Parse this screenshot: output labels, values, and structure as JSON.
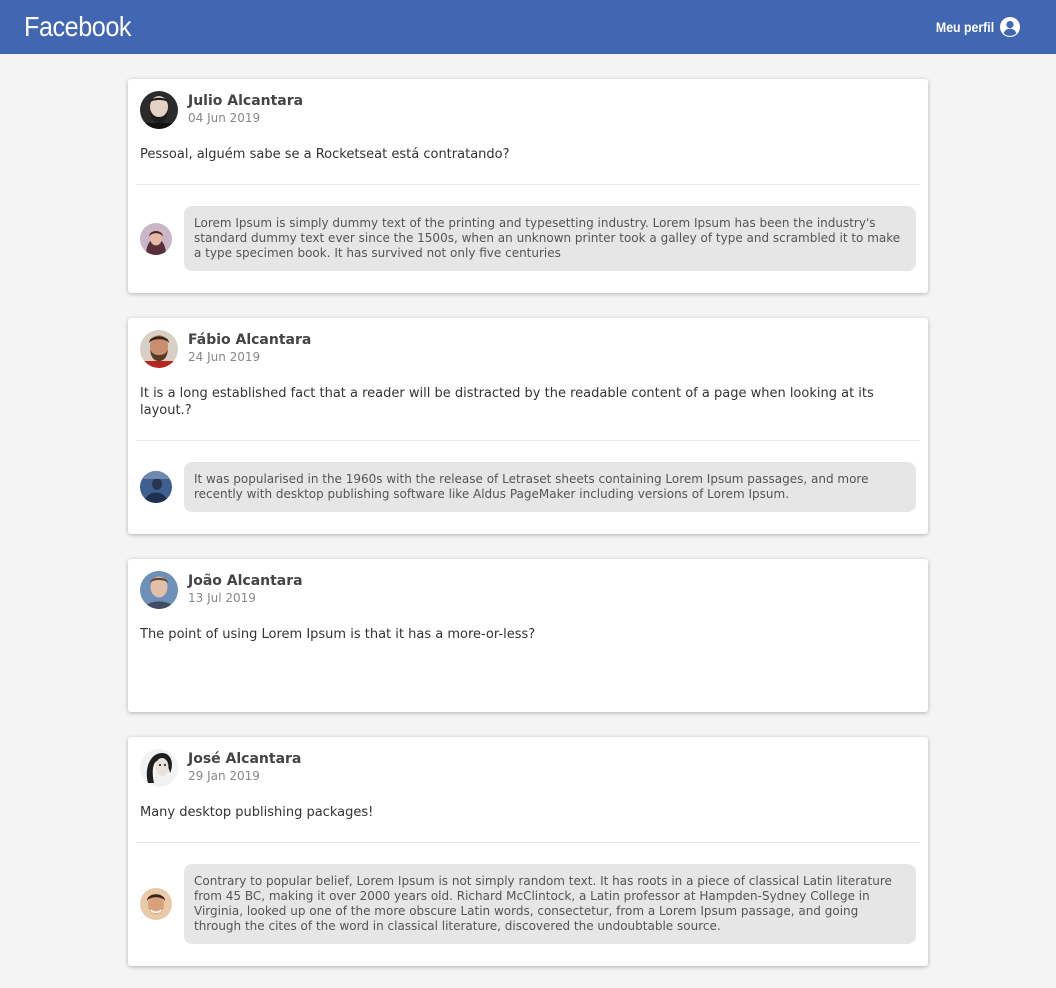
{
  "header": {
    "logo": "Facebook",
    "profile_label": "Meu perfil",
    "profile_icon": "user-circle-icon",
    "background": "#4267b2"
  },
  "posts": [
    {
      "author": "Julio Alcantara",
      "date": "04 Jun 2019",
      "content": "Pessoal, alguém sabe se a Rocketseat está contratando?",
      "comments": [
        {
          "content": "Lorem Ipsum is simply dummy text of the printing and typesetting industry. Lorem Ipsum has been the industry's standard dummy text ever since the 1500s, when an unknown printer took a galley of type and scrambled it to make a type specimen book. It has survived not only five centuries"
        }
      ]
    },
    {
      "author": "Fábio Alcantara",
      "date": "24 Jun 2019",
      "content": "It is a long established fact that a reader will be distracted by the readable content of a page when looking at its layout.?",
      "comments": [
        {
          "content": "It was popularised in the 1960s with the release of Letraset sheets containing Lorem Ipsum passages, and more recently with desktop publishing software like Aldus PageMaker including versions of Lorem Ipsum."
        }
      ]
    },
    {
      "author": "João Alcantara",
      "date": "13 Jul 2019",
      "content": "The point of using Lorem Ipsum is that it has a more-or-less?",
      "comments": []
    },
    {
      "author": "José Alcantara",
      "date": "29 Jan 2019",
      "content": "Many desktop publishing packages!",
      "comments": [
        {
          "content": "Contrary to popular belief, Lorem Ipsum is not simply random text. It has roots in a piece of classical Latin literature from 45 BC, making it over 2000 years old. Richard McClintock, a Latin professor at Hampden-Sydney College in Virginia, looked up one of the more obscure Latin words, consectetur, from a Lorem Ipsum passage, and going through the cites of the word in classical literature, discovered the undoubtable source."
        }
      ]
    }
  ]
}
